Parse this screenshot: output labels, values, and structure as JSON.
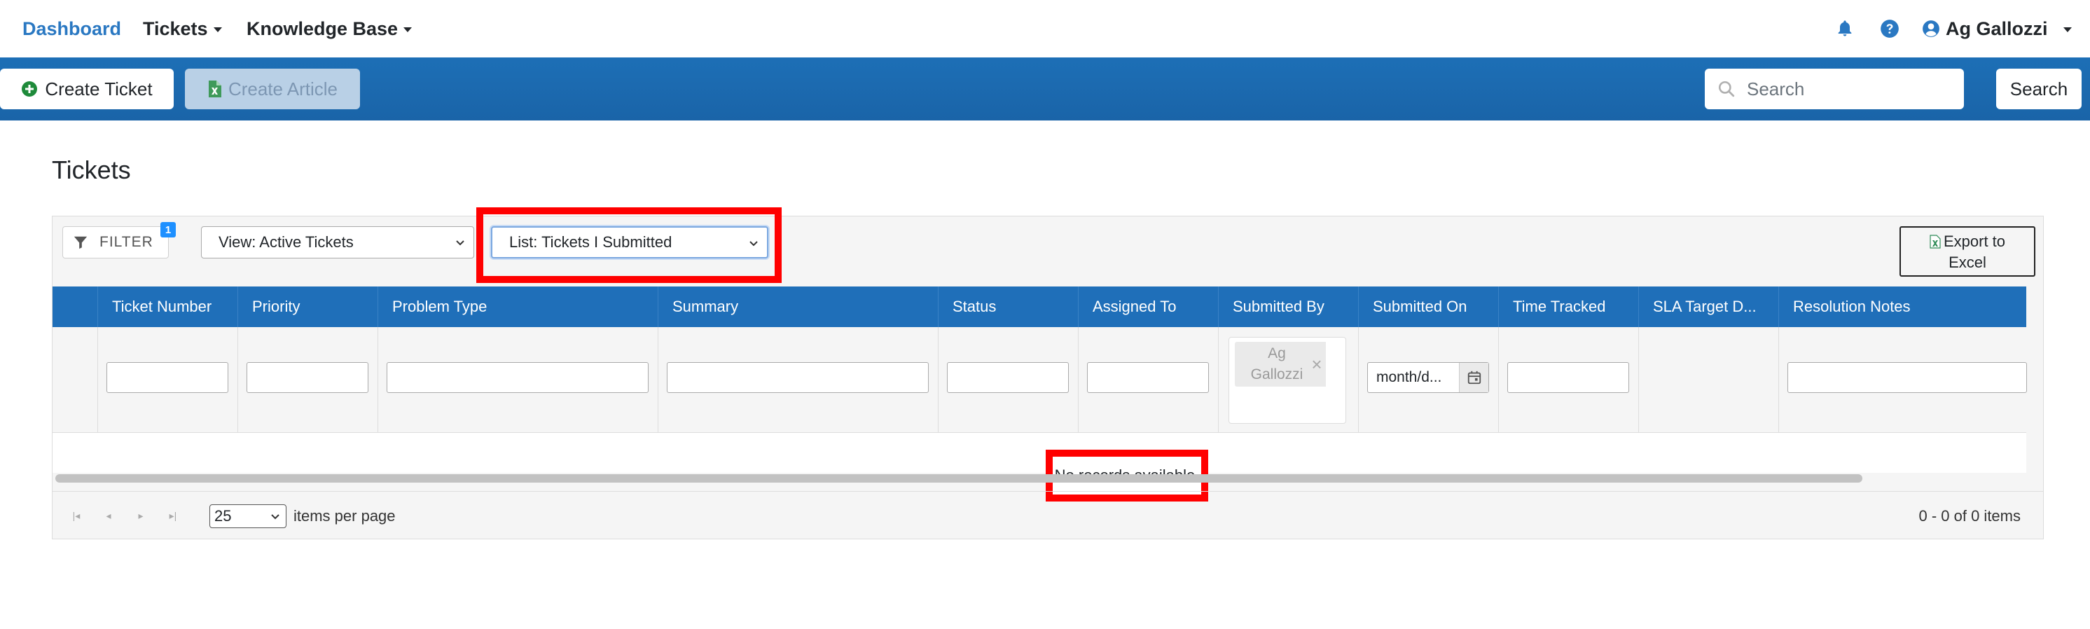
{
  "nav": {
    "brand": "Dashboard",
    "tickets": "Tickets",
    "knowledge_base": "Knowledge Base",
    "user_name": "Ag Gallozzi"
  },
  "actions": {
    "create_ticket": "Create Ticket",
    "create_article": "Create Article",
    "search_placeholder": "Search",
    "search_button": "Search"
  },
  "page": {
    "title": "Tickets"
  },
  "toolbar": {
    "filter_label": "FILTER",
    "filter_count": "1",
    "view_select": "View: Active Tickets",
    "list_select": "List: Tickets I Submitted",
    "export_line1": "Export to",
    "export_line2": "Excel"
  },
  "columns": [
    "Ticket Number",
    "Priority",
    "Problem Type",
    "Summary",
    "Status",
    "Assigned To",
    "Submitted By",
    "Submitted On",
    "Time Tracked",
    "SLA Target D...",
    "Resolution Notes"
  ],
  "filters": {
    "submitted_by_chip_line1": "Ag",
    "submitted_by_chip_line2": "Gallozzi",
    "submitted_on_placeholder": "month/d..."
  },
  "body": {
    "empty_message": "No records available."
  },
  "pager": {
    "page_size": "25",
    "items_per_page": "items per page",
    "info": "0 - 0 of 0 items"
  },
  "colors": {
    "brand": "#2a78c2",
    "header_bar": "#1f6fb9",
    "highlight": "#ff0000"
  },
  "icons": [
    "bell-icon",
    "help-icon",
    "user-icon",
    "plus-circle-icon",
    "excel-file-icon",
    "search-icon",
    "filter-icon",
    "calendar-icon"
  ]
}
